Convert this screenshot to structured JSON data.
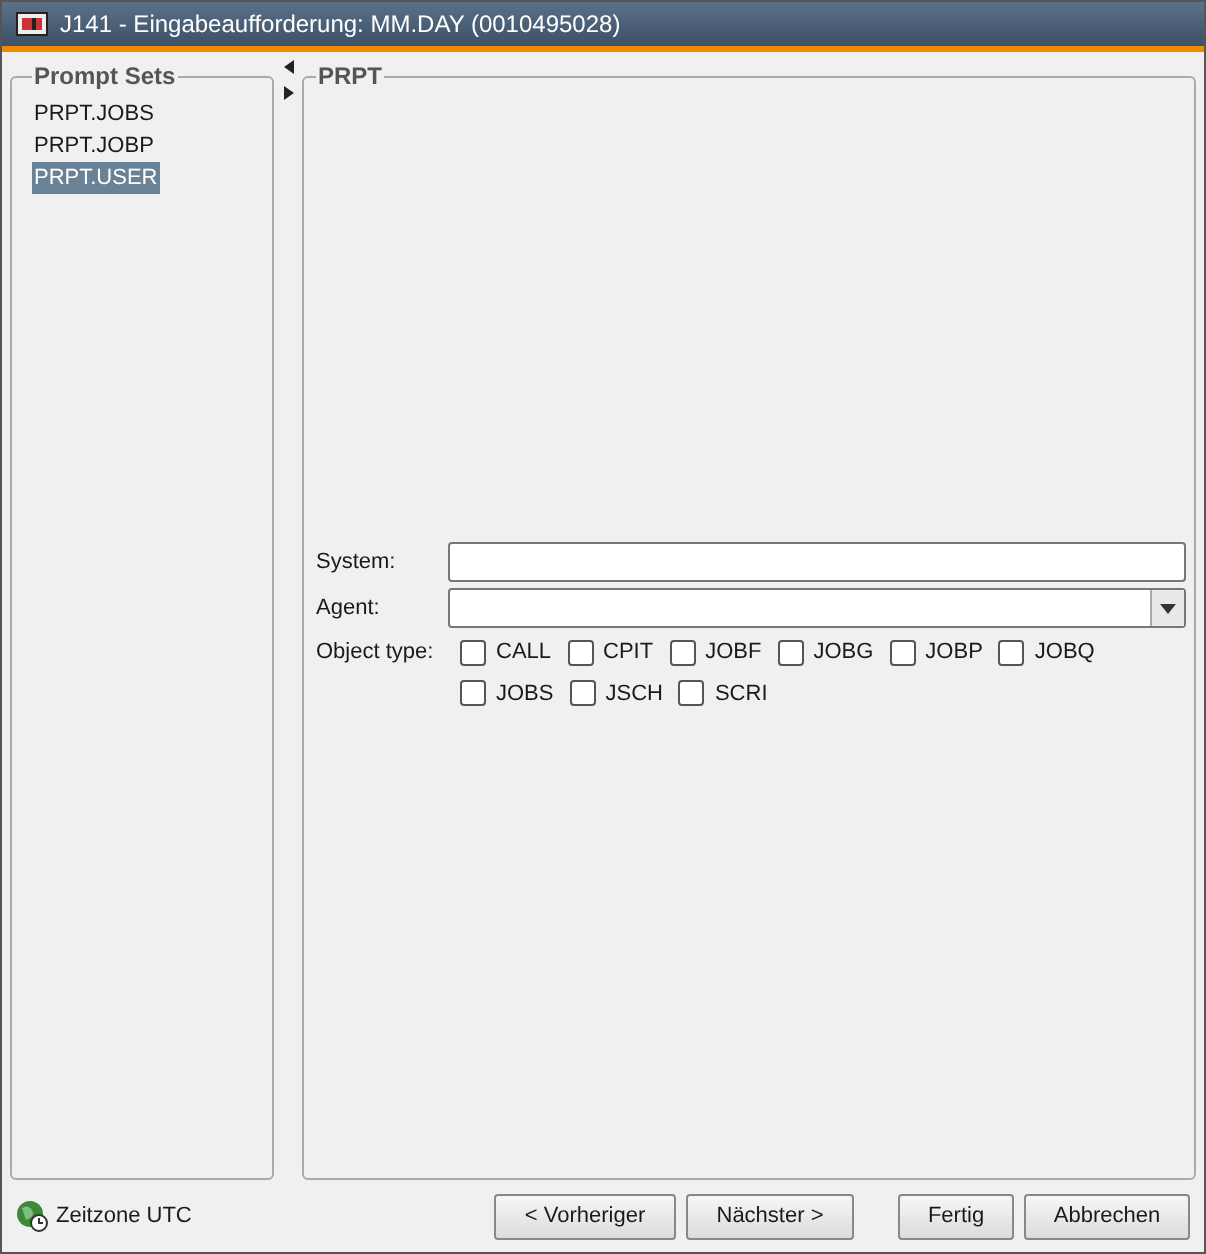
{
  "window": {
    "title": "J141 - Eingabeaufforderung: MM.DAY (0010495028)"
  },
  "prompt_sets": {
    "title": "Prompt Sets",
    "items": [
      {
        "label": "PRPT.JOBS",
        "selected": false
      },
      {
        "label": "PRPT.JOBP",
        "selected": false
      },
      {
        "label": "PRPT.USER",
        "selected": true
      }
    ]
  },
  "panel": {
    "title": "PRPT",
    "fields": [
      {
        "kind": "text",
        "label": "System:"
      },
      {
        "kind": "dropdown",
        "label": "Agent:"
      }
    ],
    "object_type": {
      "label": "Object type:",
      "options": [
        {
          "label": "CALL",
          "checked": false
        },
        {
          "label": "CPIT",
          "checked": false
        },
        {
          "label": "JOBF",
          "checked": false
        },
        {
          "label": "JOBG",
          "checked": false
        },
        {
          "label": "JOBP",
          "checked": false
        },
        {
          "label": "JOBQ",
          "checked": false
        },
        {
          "label": "JOBS",
          "checked": false
        },
        {
          "label": "JSCH",
          "checked": false
        },
        {
          "label": "SCRI",
          "checked": false
        }
      ]
    }
  },
  "status": "Zeitzone UTC",
  "buttons": [
    "< Vorheriger",
    "Nächster >",
    "Fertig",
    "Abbrechen"
  ]
}
